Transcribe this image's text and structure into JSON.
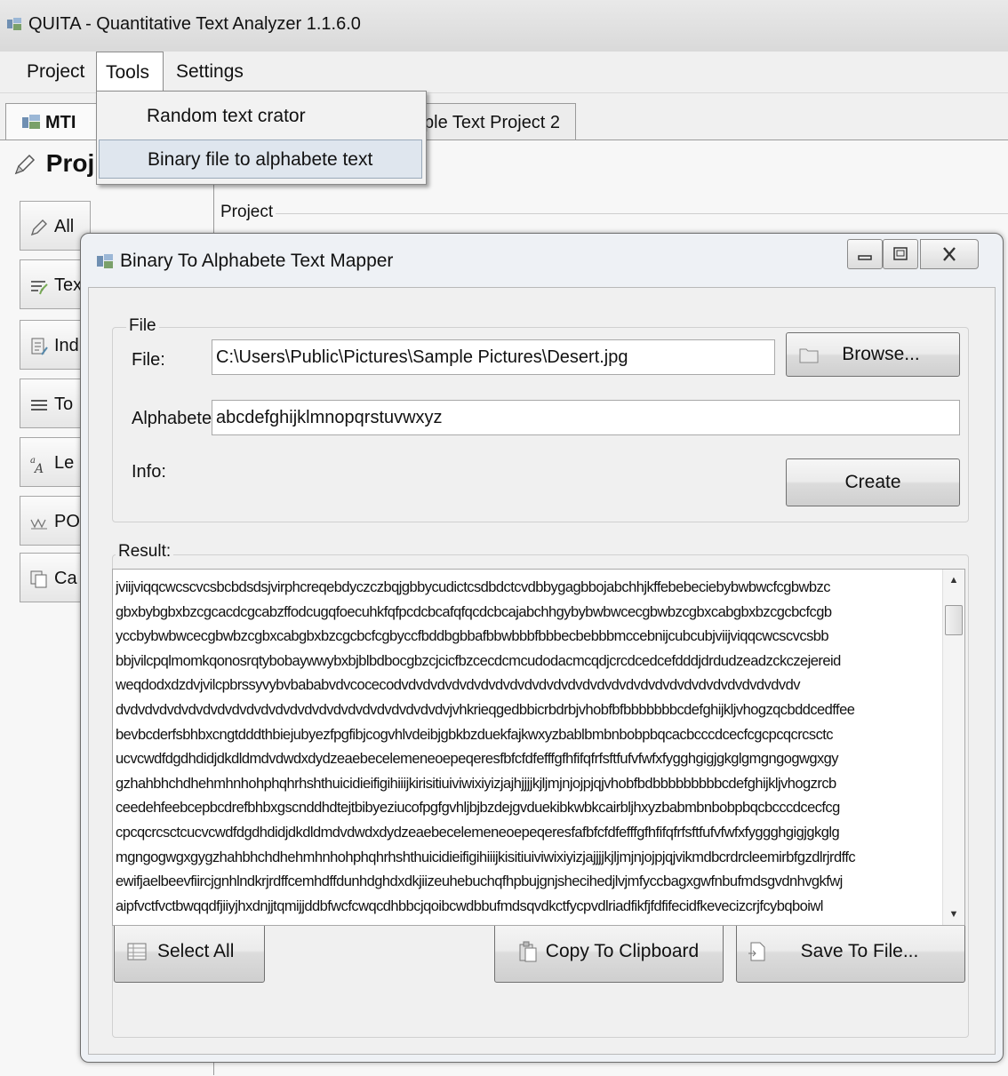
{
  "app": {
    "title": "QUITA - Quantitative Text Analyzer 1.1.6.0"
  },
  "menu": {
    "items": [
      "Project",
      "Tools",
      "Settings"
    ]
  },
  "tools_menu": {
    "items": [
      "Random text crator",
      "Binary file to alphabete text"
    ]
  },
  "tabs": [
    "MTI",
    "ple Text Project 2"
  ],
  "project": {
    "heading": "Proj",
    "group_label": "Project"
  },
  "sidebar": {
    "items": [
      "All",
      "Tex",
      "Ind",
      "To",
      "Le",
      "PO",
      "Ca"
    ]
  },
  "dialog": {
    "title": "Binary To Alphabete Text Mapper",
    "file_group": "File",
    "file_label": "File:",
    "file_value": "C:\\Users\\Public\\Pictures\\Sample Pictures\\Desert.jpg",
    "browse_label": "Browse...",
    "alphabet_label": "Alphabete:",
    "alphabet_value": "abcdefghijklmnopqrstuvwxyz",
    "info_label": "Info:",
    "create_label": "Create",
    "result_label": "Result:",
    "result_lines": [
      "jviijviqqcwcscvcsbcbdsdsjvirphcreqebdyczczbqjgbbycudictcsdbdctcvdbbygagbbojabchhjkffebebeciebybwbwcfcgbwbzc",
      "gbxbybgbxbzcgcacdcgcabzffodcugqfoecuhkfqfpcdcbcafqfqcdcbcajabchhgybybwbwcecgbwbzcgbxcabgbxbzcgcbcfcgb",
      "yccbybwbwcecgbwbzcgbxcabgbxbzcgcbcfcgbyccfbddbgbbafbbwbbbfbbbecbebbbmccebnijcubcubjviijviqqcwcscvcsbb",
      "bbjvilcpqlmomkqonosrqtybobaywwybxbjblbdbocgbzcjcicfbzcecdcmcudodacmcqdjcrcdcedcefdddjdrdudzeadzckczejereid",
      "weqdodxdzdvjvilcpbrssyvybvbababvdvcocecodvdvdvdvdvdvdvdvdvdvdvdvdvdvdvdvdvdvdvdvdvdvdvdvdvdvdvdv",
      "dvdvdvdvdvdvdvdvdvdvdvdvdvdvdvdvdvdvdvdvdvdvdvjvhkrieqgedbbicrbdrbjvhobfbfbbbbbbbcdefghijkljvhogzqcbddcedffee",
      "bevbcderfsbhbxcngtdddthbiejubyezfpgfibjcogvhlvdeibjgbkbzduekfajkwxyzbablbmbnbobpbqcacbcccdcecfcgcpcqcrcsctc",
      "ucvcwdfdgdhdidjdkdldmdvdwdxdydzeaebecelemeneoepeqeresfbfcfdfefffgfhfifqfrfsftfufvfwfxfygghgigjgkglgmgngogwgxgy",
      "gzhahbhchdhehmhnhohphqhrhshthuicidieifigihiiijkirisitiuiviwixiyizjajhjjjjkjljmjnjojpjqjvhobfbdbbbbbbbbbcdefghijkljvhogzrcb",
      "ceedehfeebcepbcdrefbhbxgscnddhdtejtbibyeziucofpgfgvhljbjbzdejgvduekibkwbkcairbljhxyzbabmbnbobpbqcbcccdcecfcg",
      "cpcqcrcsctcucvcwdfdgdhdidjdkdldmdvdwdxdydzeaebecelemeneoepeqeresfafbfcfdfefffgfhfifqfrfsftfufvfwfxfyggghgigjgkglg",
      "mgngogwgxgygzhahbhchdhehmhnhohphqhrhshthuicidieifigihiiijkisitiuiviwixiyizjajjjjkjljmjnjojpjqjvikmdbcrdrcleemirbfgzdlrjrdffc",
      "ewifjaelbeevfiircjgnhlndkrjrdffcemhdffdunhdghdxdkjiizeuhebuchqfhpbujgnjshecihedjlvjmfyccbagxgwfnbufmdsgvdnhvgkfwj",
      "aipfvctfvctbwqqdfjiiyjhxdnjjtqmijjddbfwcfcwqcdhbbcjqoibcwdbbufmdsqvdkctfycpvdlriadfikfjfdfifecidfkevecizcrjfcybqboiwl"
    ],
    "select_all_label": "Select All",
    "copy_label": "Copy To Clipboard",
    "save_label": "Save To File..."
  }
}
